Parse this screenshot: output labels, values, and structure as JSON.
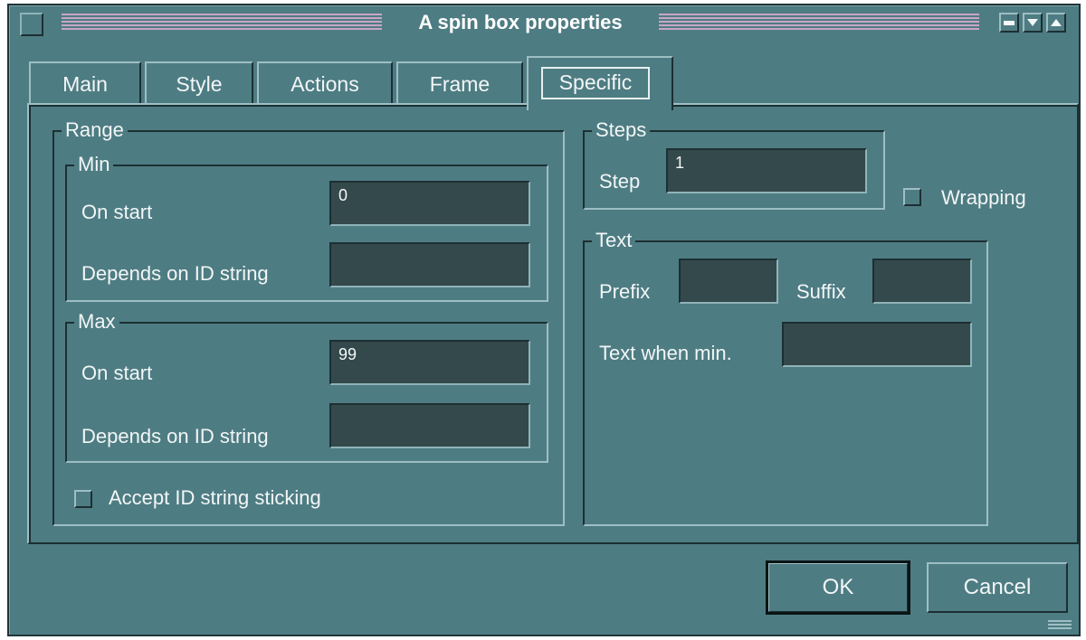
{
  "window": {
    "title": "A spin box properties"
  },
  "tabs": [
    {
      "label": "Main",
      "active": false
    },
    {
      "label": "Style",
      "active": false
    },
    {
      "label": "Actions",
      "active": false
    },
    {
      "label": "Frame",
      "active": false
    },
    {
      "label": "Specific",
      "active": true
    }
  ],
  "range": {
    "legend": "Range",
    "min": {
      "legend": "Min",
      "on_start_label": "On start",
      "on_start_value": "0",
      "depends_label": "Depends on ID string",
      "depends_value": ""
    },
    "max": {
      "legend": "Max",
      "on_start_label": "On start",
      "on_start_value": "99",
      "depends_label": "Depends on ID string",
      "depends_value": ""
    },
    "accept_label": "Accept ID string sticking"
  },
  "steps": {
    "legend": "Steps",
    "step_label": "Step",
    "step_value": "1"
  },
  "wrapping_label": "Wrapping",
  "text": {
    "legend": "Text",
    "prefix_label": "Prefix",
    "prefix_value": "",
    "suffix_label": "Suffix",
    "suffix_value": "",
    "when_min_label": "Text when min.",
    "when_min_value": ""
  },
  "buttons": {
    "ok": "OK",
    "cancel": "Cancel"
  }
}
